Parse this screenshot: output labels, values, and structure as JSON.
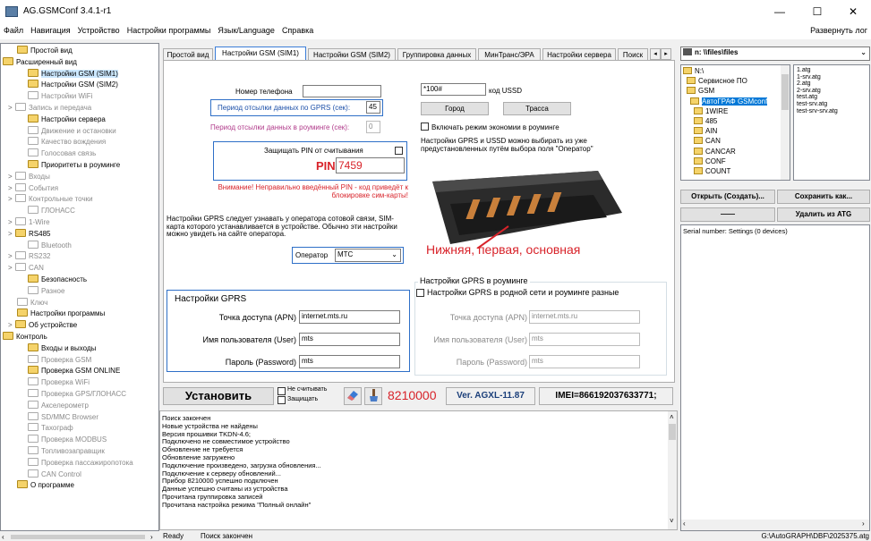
{
  "window": {
    "title": "AG.GSMConf 3.4.1-r1",
    "min": "—",
    "max": "☐",
    "close": "✕"
  },
  "menu": {
    "items": [
      "Файл",
      "Навигация",
      "Устройство",
      "Настройки программы",
      "Язык/Language",
      "Справка"
    ],
    "expand_log": "Развернуть лог"
  },
  "tree": [
    {
      "label": "Простой вид",
      "level": 1,
      "state": "normal",
      "toggle": ""
    },
    {
      "label": "Расширенный вид",
      "level": 0,
      "state": "open",
      "toggle": "v"
    },
    {
      "label": "Настройки GSM (SIM1)",
      "level": 2,
      "state": "selected",
      "toggle": ""
    },
    {
      "label": "Настройки GSM (SIM2)",
      "level": 2,
      "state": "normal",
      "toggle": ""
    },
    {
      "label": "Настройки WiFi",
      "level": 2,
      "state": "dim",
      "toggle": ""
    },
    {
      "label": "Запись и передача",
      "level": 1,
      "state": "dim",
      "toggle": ">"
    },
    {
      "label": "Настройки сервера",
      "level": 2,
      "state": "normal",
      "toggle": ""
    },
    {
      "label": "Движение и остановки",
      "level": 2,
      "state": "dim",
      "toggle": ""
    },
    {
      "label": "Качество вождения",
      "level": 2,
      "state": "dim",
      "toggle": ""
    },
    {
      "label": "Голосовая связь",
      "level": 2,
      "state": "dim",
      "toggle": ""
    },
    {
      "label": "Приоритеты в роуминге",
      "level": 2,
      "state": "normal",
      "toggle": ""
    },
    {
      "label": "Входы",
      "level": 1,
      "state": "dim",
      "toggle": ">"
    },
    {
      "label": "События",
      "level": 1,
      "state": "dim",
      "toggle": ">"
    },
    {
      "label": "Контрольные точки",
      "level": 1,
      "state": "dim",
      "toggle": ">"
    },
    {
      "label": "ГЛОНАСС",
      "level": 2,
      "state": "dim",
      "toggle": ""
    },
    {
      "label": "1-Wire",
      "level": 1,
      "state": "dim",
      "toggle": ">"
    },
    {
      "label": "RS485",
      "level": 1,
      "state": "normal",
      "toggle": ">"
    },
    {
      "label": "Bluetooth",
      "level": 2,
      "state": "dim",
      "toggle": ""
    },
    {
      "label": "RS232",
      "level": 1,
      "state": "dim",
      "toggle": ">"
    },
    {
      "label": "CAN",
      "level": 1,
      "state": "dim",
      "toggle": ">"
    },
    {
      "label": "Безопасность",
      "level": 2,
      "state": "normal",
      "toggle": ""
    },
    {
      "label": "Разное",
      "level": 2,
      "state": "dim",
      "toggle": ""
    },
    {
      "label": "Ключ",
      "level": 1,
      "state": "dim",
      "toggle": ""
    },
    {
      "label": "Настройки программы",
      "level": 1,
      "state": "normal",
      "toggle": ""
    },
    {
      "label": "Об устройстве",
      "level": 1,
      "state": "normal",
      "toggle": ">"
    },
    {
      "label": "Контроль",
      "level": 0,
      "state": "open",
      "toggle": "v"
    },
    {
      "label": "Входы и выходы",
      "level": 2,
      "state": "normal",
      "toggle": ""
    },
    {
      "label": "Проверка GSM",
      "level": 2,
      "state": "dim",
      "toggle": ""
    },
    {
      "label": "Проверка GSM ONLINE",
      "level": 2,
      "state": "normal",
      "toggle": ""
    },
    {
      "label": "Проверка WiFi",
      "level": 2,
      "state": "dim",
      "toggle": ""
    },
    {
      "label": "Проверка GPS/ГЛОНАСС",
      "level": 2,
      "state": "dim",
      "toggle": ""
    },
    {
      "label": "Акселерометр",
      "level": 2,
      "state": "dim",
      "toggle": ""
    },
    {
      "label": "SD/MMC Browser",
      "level": 2,
      "state": "dim",
      "toggle": ""
    },
    {
      "label": "Тахограф",
      "level": 2,
      "state": "dim",
      "toggle": ""
    },
    {
      "label": "Проверка MODBUS",
      "level": 2,
      "state": "dim",
      "toggle": ""
    },
    {
      "label": "Топливозаправщик",
      "level": 2,
      "state": "dim",
      "toggle": ""
    },
    {
      "label": "Проверка пассажиропотока",
      "level": 2,
      "state": "dim",
      "toggle": ""
    },
    {
      "label": "CAN Control",
      "level": 2,
      "state": "dim",
      "toggle": ""
    },
    {
      "label": "О программе",
      "level": 1,
      "state": "normal",
      "toggle": ""
    }
  ],
  "tabs": [
    "Простой вид",
    "Настройки GSM (SIM1)",
    "Настройки GSM (SIM2)",
    "Группировка данных",
    "МинТранс/ЭРА",
    "Настройки сервера",
    "Поиск"
  ],
  "form": {
    "phone_label": "Номер телефона",
    "phone_value": "",
    "gprs_period_label": "Период отсылки данных по GPRS (сек):",
    "gprs_period_value": "45",
    "roaming_period_label": "Период отсылки данных в роуминге (сек):",
    "roaming_period_value": "0",
    "pin_protect_label": "Защищать PIN от считывания",
    "pin_label": "PIN",
    "pin_value": "7459",
    "pin_warning": "Внимание! Неправильно введённый PIN - код приведёт к блокировке сим-карты!",
    "gprs_note": "Настройки GPRS следует узнавать у оператора сотовой связи, SIM-карта которого устанавливается в устройстве. Обычно эти настройки можно увидеть на сайте оператора.",
    "operator_label": "Оператор",
    "operator_value": "МТС",
    "ussd_value": "*100#",
    "ussd_label": "код USSD",
    "city_button": "Город",
    "trace_button": "Трасса",
    "roaming_economy_label": "Включать режим экономии в роуминге",
    "ussd_note": "Настройки GPRS и USSD можно выбирать из уже предустановленных путём выбора поля \"Оператор\"",
    "sim_caption": "Нижняя, первая, основная",
    "gprs_group_title": "Настройки GPRS",
    "apn_label": "Точка доступа (APN)",
    "apn_value": "internet.mts.ru",
    "user_label": "Имя пользователя (User)",
    "user_value": "mts",
    "pass_label": "Пароль (Password)",
    "pass_value": "mts",
    "roaming_group_title": "Настройки GPRS в роуминге",
    "roaming_same_label": "Настройки GPRS в родной сети и роуминге разные",
    "r_apn_value": "internet.mts.ru",
    "r_user_value": "mts",
    "r_pass_value": "mts"
  },
  "toolbar": {
    "install_button": "Установить",
    "no_read_label": "Не считывать",
    "protect_label": "Защищать",
    "device_id": "8210000",
    "version": "Ver. AGXL-11.87",
    "imei": "IMEI=866192037633771;"
  },
  "log": [
    "Поиск закончен",
    "Новые устройства не найдены",
    "Версия прошивки TKDN-4.6;",
    "Подключено не совместимое устройство",
    "Обновление не требуется",
    "Обновление загружено",
    "Подключение произведено, загрузка обновления...",
    "Подключение к серверу обновлений...",
    "Прибор 8210000 успешно подключен",
    "Данные успешно считаны из устройства",
    "Прочитана группировка записей",
    "Прочитана настройка режима \"Полный онлайн\""
  ],
  "status": {
    "ready": "Ready",
    "message": "Поиск закончен",
    "path": "G:\\AutoGRAPH\\DBF\\2025375.atg"
  },
  "right": {
    "drive": "n: \\\\files\\files",
    "folders": [
      "N:\\",
      "Сервисное ПО",
      "GSM",
      "АвтоГРАФ GSMconf",
      "1WIRE",
      "485",
      "AIN",
      "CAN",
      "CANCAR",
      "CONF",
      "COUNT"
    ],
    "files": [
      "1.atg",
      "1-srv.atg",
      "2.atg",
      "2-srv.atg",
      "test.atg",
      "test-srv.atg",
      "test-srv-srv.atg"
    ],
    "open_button": "Открыть (Создать)...",
    "save_button": "Сохранить как...",
    "dash_button": "——",
    "delete_button": "Удалить из ATG",
    "serial": "Serial number: Settings (0 devices)"
  }
}
